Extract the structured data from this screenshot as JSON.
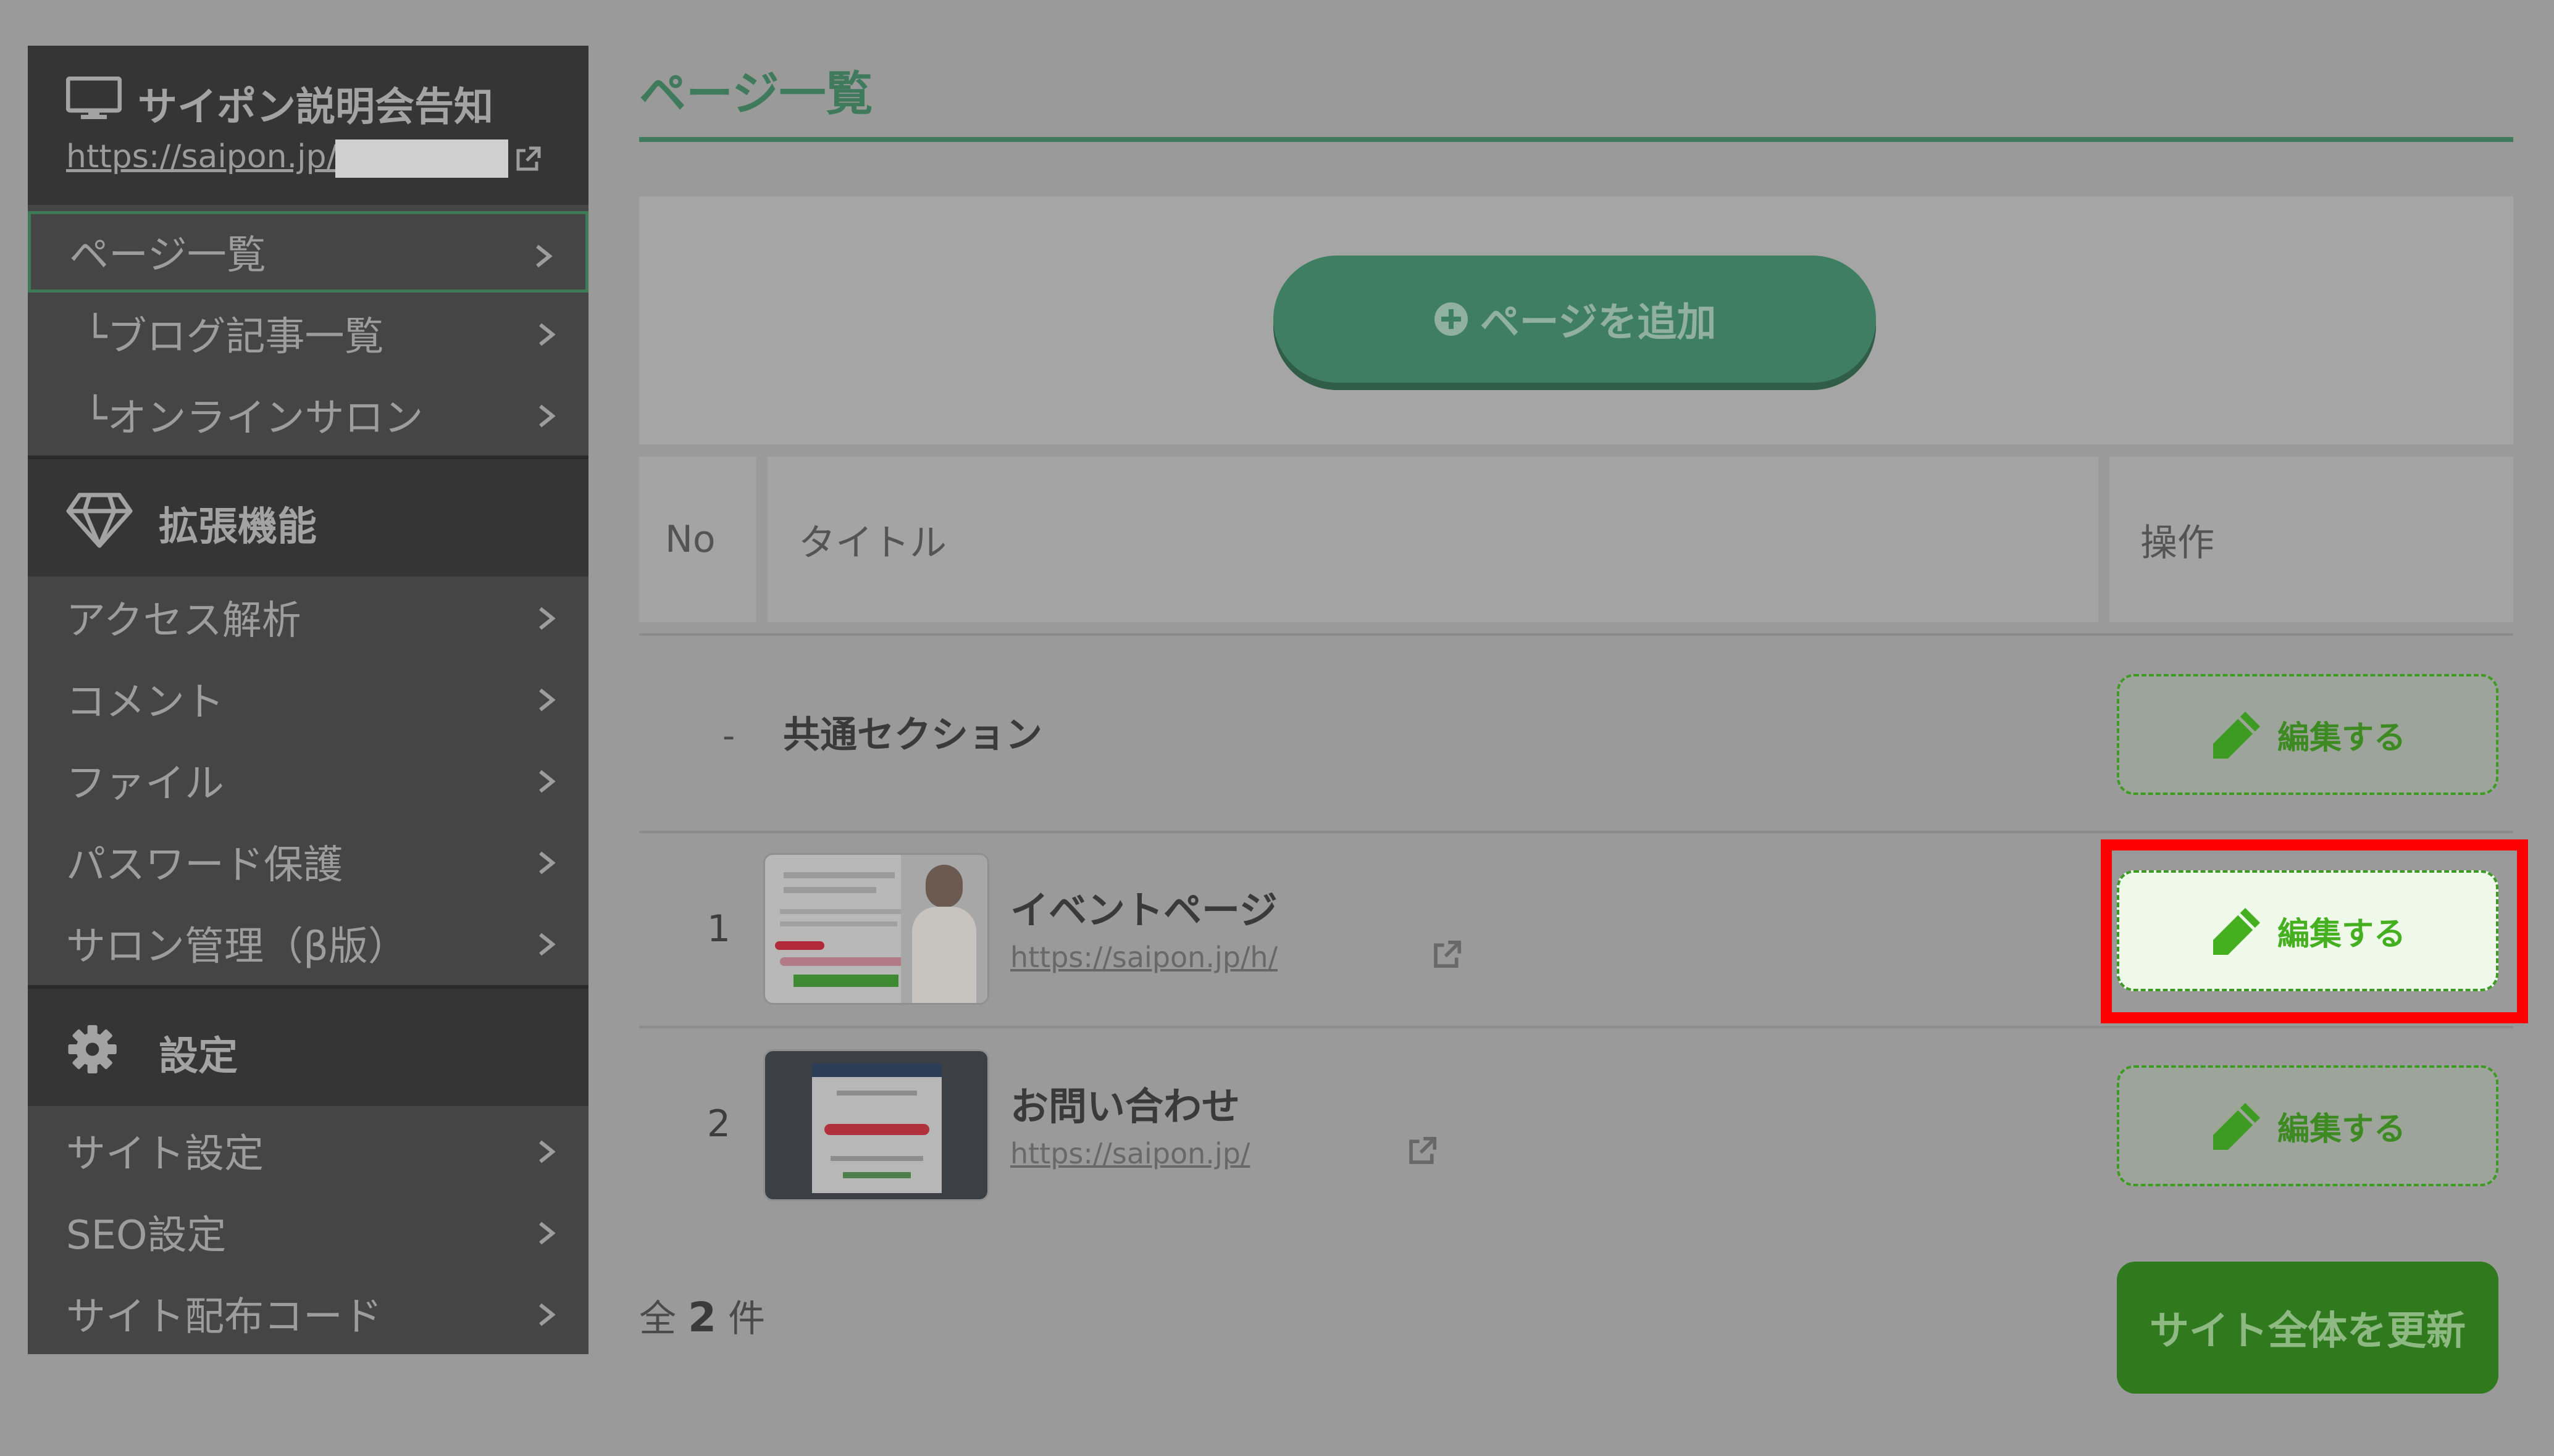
{
  "sidebar": {
    "site_title": "サイポン説明会告知",
    "site_url": "https://saipon.jp/",
    "items_top": [
      {
        "label": "ページ一覧",
        "active": true
      },
      {
        "label": "└ブログ記事一覧"
      },
      {
        "label": "└オンラインサロン"
      }
    ],
    "section_ext": "拡張機能",
    "items_ext": [
      {
        "label": "アクセス解析"
      },
      {
        "label": "コメント"
      },
      {
        "label": "ファイル"
      },
      {
        "label": "パスワード保護"
      },
      {
        "label": "サロン管理（β版）"
      }
    ],
    "section_settings": "設定",
    "items_settings": [
      {
        "label": "サイト設定"
      },
      {
        "label": "SEO設定"
      },
      {
        "label": "サイト配布コード"
      }
    ]
  },
  "main": {
    "title": "ページ一覧",
    "add_button": "ページを追加",
    "table": {
      "headers": {
        "no": "No",
        "title": "タイトル",
        "ops": "操作"
      },
      "common": {
        "dash": "-",
        "label": "共通セクション",
        "edit": "編集する"
      },
      "rows": [
        {
          "no": "1",
          "name": "イベントページ",
          "url": "https://saipon.jp/h/",
          "edit": "編集する"
        },
        {
          "no": "2",
          "name": "お問い合わせ",
          "url": "https://saipon.jp/",
          "edit": "編集する"
        }
      ]
    },
    "total_prefix": "全",
    "total_count": "2",
    "total_suffix": "件",
    "refresh_button": "サイト全体を更新"
  },
  "colors": {
    "accent_green": "#3f7a5d",
    "edit_green": "#3d9a22",
    "highlight_red": "#ff0000"
  },
  "icons": {
    "monitor": "monitor-icon",
    "diamond": "diamond-icon",
    "gear": "gear-icon",
    "external": "external-link-icon",
    "pencil": "pencil-icon",
    "plus": "plus-circle-icon",
    "chevron": "chevron-right-icon"
  }
}
